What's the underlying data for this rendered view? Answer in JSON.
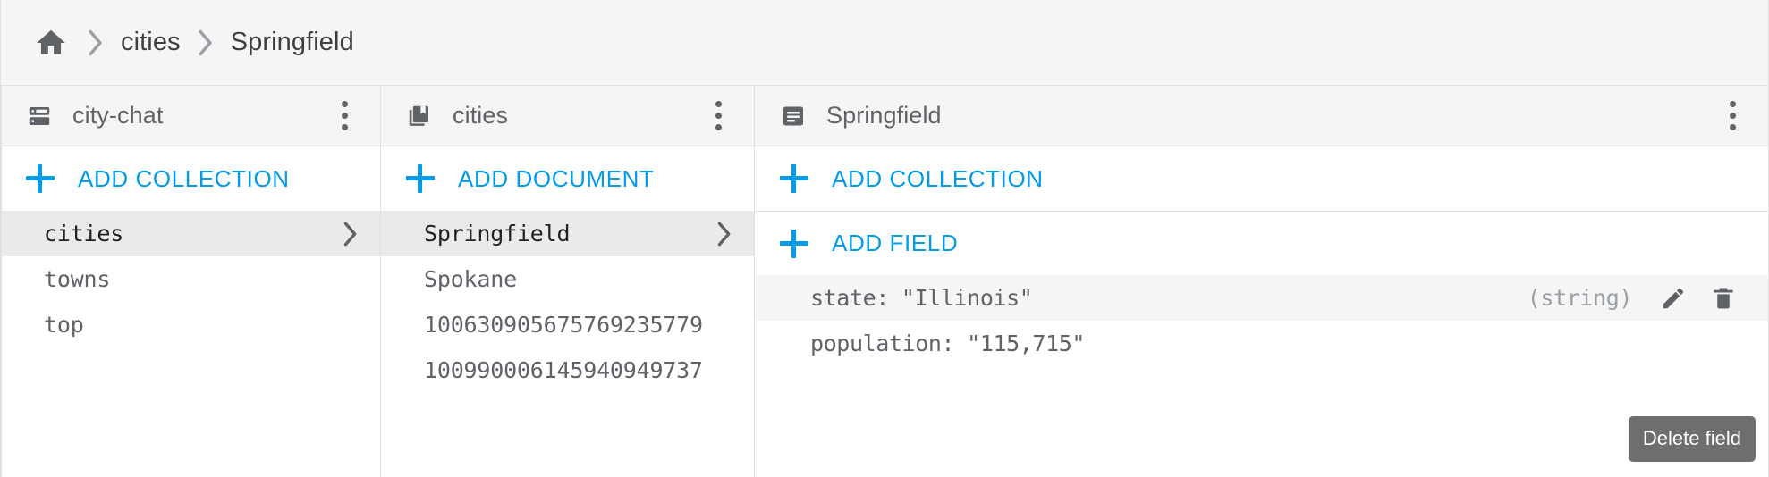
{
  "breadcrumb": {
    "home_icon": "home-icon",
    "separator_icon": "chevron-right-icon",
    "items": [
      {
        "label": "cities",
        "current": false
      },
      {
        "label": "Springfield",
        "current": true
      }
    ]
  },
  "colors": {
    "accent_blue": "#039be5",
    "header_bg": "#f5f5f5",
    "selected_bg": "#eaeaea",
    "text_primary": "#202124",
    "text_secondary": "#5f6368",
    "text_muted": "#9aa0a6",
    "divider": "#e0e0e0",
    "tooltip_bg": "#6e6e6e"
  },
  "panels": {
    "database": {
      "icon": "database-icon",
      "title": "city-chat",
      "menu_icon": "more-vert-icon",
      "add_button": {
        "label": "ADD COLLECTION",
        "icon": "plus-icon"
      },
      "items": [
        {
          "label": "cities",
          "selected": true,
          "chevron": "chevron-right-icon"
        },
        {
          "label": "towns",
          "selected": false,
          "chevron": ""
        },
        {
          "label": "top",
          "selected": false,
          "chevron": ""
        }
      ]
    },
    "collection": {
      "icon": "collection-icon",
      "title": "cities",
      "menu_icon": "more-vert-icon",
      "add_button": {
        "label": "ADD DOCUMENT",
        "icon": "plus-icon"
      },
      "items": [
        {
          "label": "Springfield",
          "selected": true,
          "chevron": "chevron-right-icon"
        },
        {
          "label": "Spokane",
          "selected": false,
          "chevron": ""
        },
        {
          "label": "100630905675769235779",
          "selected": false,
          "chevron": ""
        },
        {
          "label": "100990006145940949737",
          "selected": false,
          "chevron": ""
        }
      ]
    },
    "document": {
      "icon": "document-icon",
      "title": "Springfield",
      "menu_icon": "more-vert-icon",
      "add_collection_button": {
        "label": "ADD COLLECTION",
        "icon": "plus-icon"
      },
      "add_field_button": {
        "label": "ADD FIELD",
        "icon": "plus-icon"
      },
      "fields": [
        {
          "key": "state:",
          "value": "\"Illinois\"",
          "type": "(string)",
          "hovered": true,
          "edit_icon": "pencil-icon",
          "delete_icon": "trash-icon"
        },
        {
          "key": "population:",
          "value": "\"115,715\"",
          "type": "",
          "hovered": false,
          "edit_icon": "",
          "delete_icon": ""
        }
      ]
    }
  },
  "tooltip": {
    "label": "Delete field"
  }
}
